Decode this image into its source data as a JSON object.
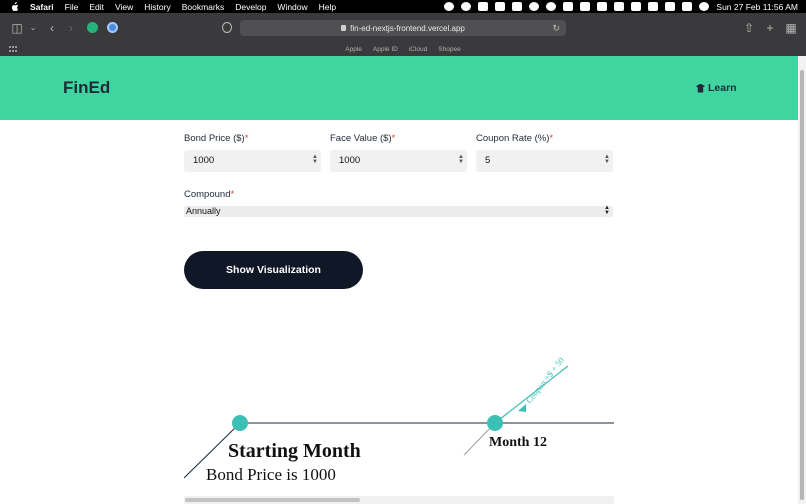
{
  "menubar": {
    "app": "Safari",
    "items": [
      "File",
      "Edit",
      "View",
      "History",
      "Bookmarks",
      "Develop",
      "Window",
      "Help"
    ],
    "datetime": "Sun 27 Feb  11:56 AM"
  },
  "browser": {
    "url": "fin-ed-nextjs-frontend.vercel.app",
    "favorites": [
      "Apple",
      "Apple ID",
      "iCloud",
      "Shopee"
    ]
  },
  "header": {
    "logo": "FinEd",
    "learn_label": "Learn",
    "color": "#3fd4a0"
  },
  "form": {
    "bond_price": {
      "label": "Bond Price ($)",
      "required": "*",
      "value": "1000"
    },
    "face_value": {
      "label": "Face Value ($)",
      "required": "*",
      "value": "1000"
    },
    "coupon_rate": {
      "label": "Coupon Rate (%)",
      "required": "*",
      "value": "5"
    },
    "compound": {
      "label": "Compound",
      "required": "*",
      "value": "Annually"
    },
    "submit_label": "Show Visualization"
  },
  "visualization": {
    "start_title": "Starting Month",
    "start_subtitle": "Bond Price is 1000",
    "milestone_label": "Month 12",
    "coupon_label": "Coupon +$ + 50",
    "node_color": "#3cbfb4"
  }
}
